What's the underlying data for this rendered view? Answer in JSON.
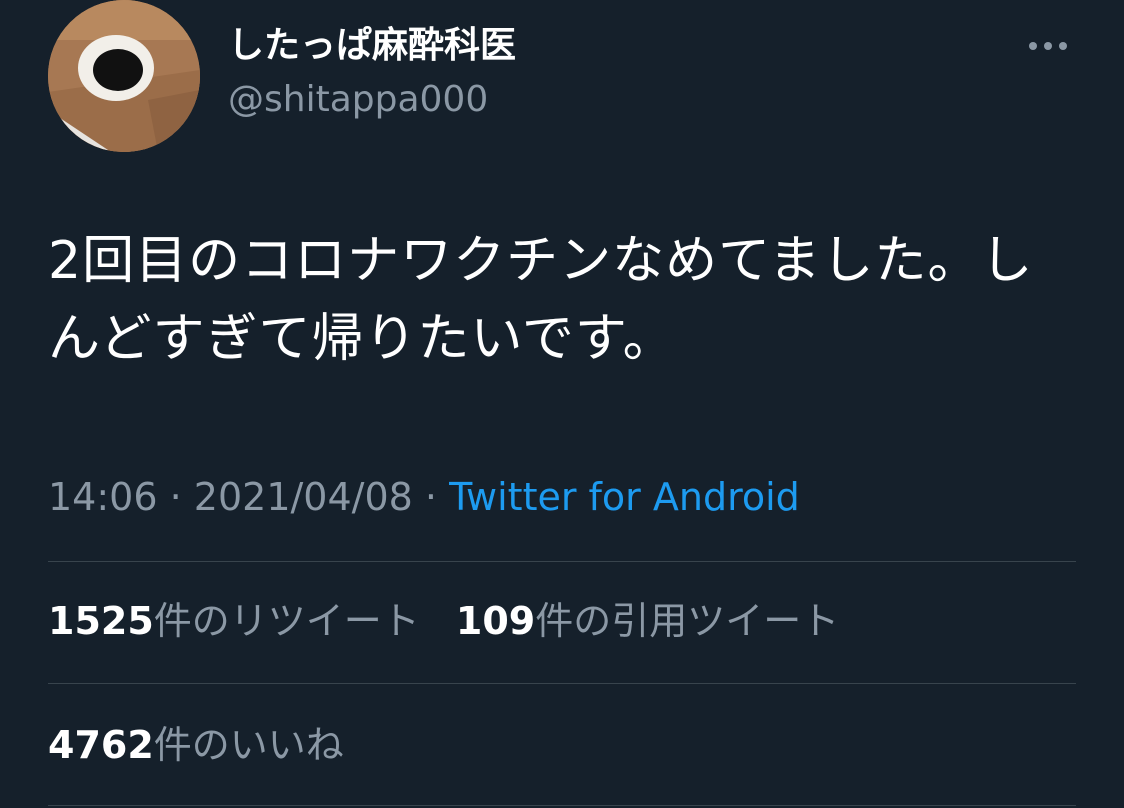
{
  "user": {
    "display_name": "したっぱ麻酔科医",
    "handle": "@shitappa000",
    "avatar_icon": "avatar-image"
  },
  "more_icon": "more-horizontal-icon",
  "tweet": {
    "text": "2回目のコロナワクチンなめてました。しんどすぎて帰りたいです。",
    "time": "14:06",
    "separator": "·",
    "date": "2021/04/08",
    "source": "Twitter for Android"
  },
  "stats": {
    "retweets": {
      "count": "1525",
      "label": "件のリツイート"
    },
    "quotes": {
      "count": "109",
      "label": "件の引用ツイート"
    },
    "likes": {
      "count": "4762",
      "label": "件のいいね"
    }
  },
  "colors": {
    "background": "#15202b",
    "text": "#ffffff",
    "secondary": "#8b98a5",
    "link": "#1d9bf0",
    "divider": "#38444d"
  }
}
